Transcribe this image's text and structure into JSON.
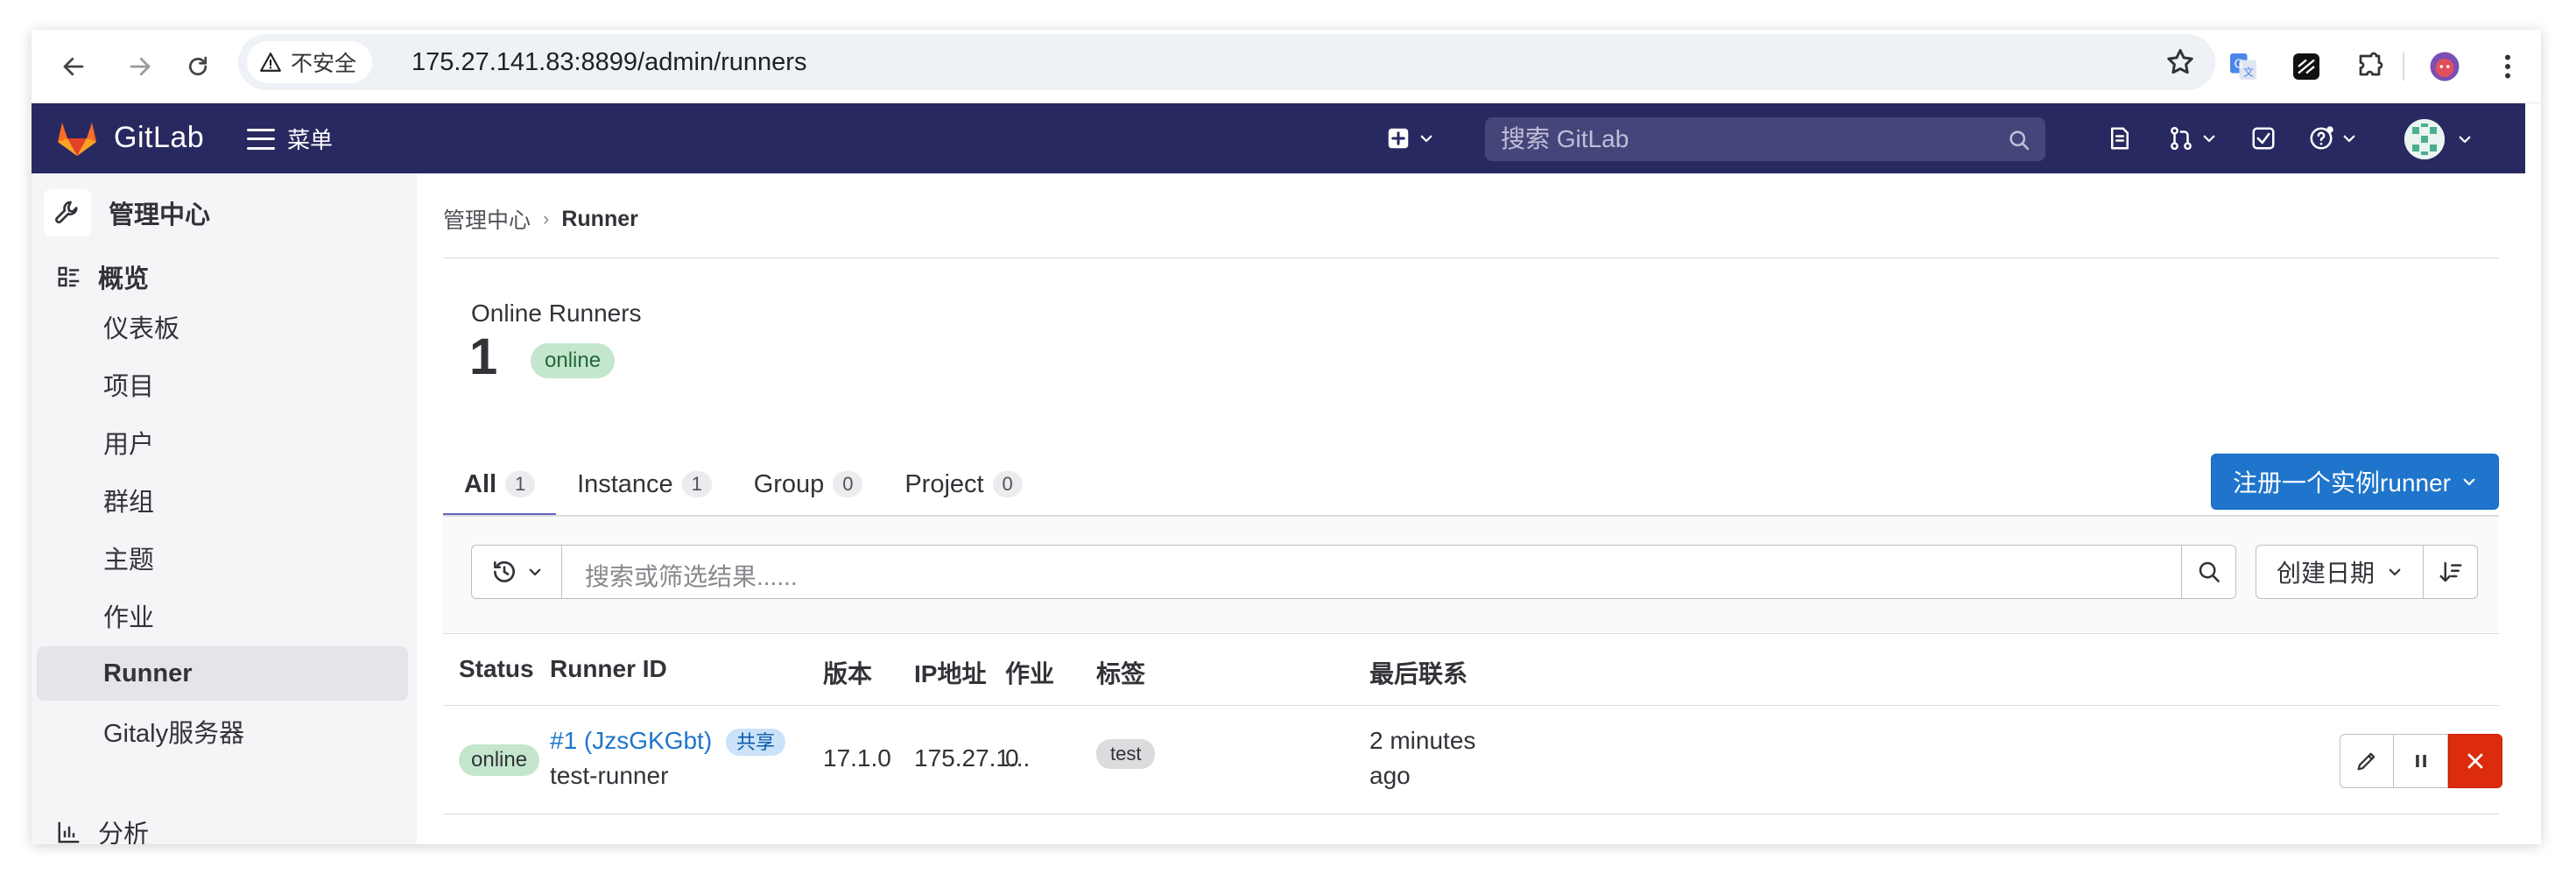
{
  "browser": {
    "security_label": "不安全",
    "url": "175.27.141.83:8899/admin/runners"
  },
  "header": {
    "brand": "GitLab",
    "menu_label": "菜单",
    "search_placeholder": "搜索 GitLab"
  },
  "sidebar": {
    "title": "管理中心",
    "section": "概览",
    "items": [
      {
        "label": "仪表板"
      },
      {
        "label": "项目"
      },
      {
        "label": "用户"
      },
      {
        "label": "群组"
      },
      {
        "label": "主题"
      },
      {
        "label": "作业"
      },
      {
        "label": "Runner"
      },
      {
        "label": "Gitaly服务器"
      }
    ],
    "next_section": "分析"
  },
  "breadcrumb": {
    "parent": "管理中心",
    "current": "Runner"
  },
  "summary": {
    "title": "Online Runners",
    "count": "1",
    "status": "online"
  },
  "tabs": [
    {
      "label": "All",
      "count": "1"
    },
    {
      "label": "Instance",
      "count": "1"
    },
    {
      "label": "Group",
      "count": "0"
    },
    {
      "label": "Project",
      "count": "0"
    }
  ],
  "register_button": "注册一个实例runner",
  "filter": {
    "placeholder": "搜索或筛选结果......",
    "sort_label": "创建日期"
  },
  "table": {
    "columns": [
      "Status",
      "Runner ID",
      "版本",
      "IP地址",
      "作业",
      "标签",
      "最后联系"
    ],
    "rows": [
      {
        "status": "online",
        "runner_id": "#1 (JzsGKGbt)",
        "shared_badge": "共享",
        "description": "test-runner",
        "version": "17.1.0",
        "ip": "175.27.1...",
        "jobs": "0",
        "tag": "test",
        "last_contact_line1": "2 minutes",
        "last_contact_line2": "ago"
      }
    ]
  },
  "colors": {
    "header_bg": "#292961",
    "primary": "#1f75cb",
    "danger": "#dd2b0e",
    "online_badge": "#c3e6cd"
  }
}
